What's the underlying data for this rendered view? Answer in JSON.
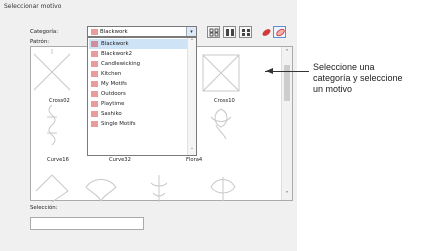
{
  "dialog": {
    "title": "Seleccionar motivo",
    "category_label": "Categoría:",
    "pattern_label": "Patrón:",
    "selection_label": "Selección:",
    "selected_category": "Blackwork"
  },
  "dropdown_items": [
    {
      "label": "Blackwork"
    },
    {
      "label": "Blackwork2"
    },
    {
      "label": "Candlewicking"
    },
    {
      "label": "Kitchen"
    },
    {
      "label": "My Motifs"
    },
    {
      "label": "Outdoors"
    },
    {
      "label": "Playtime"
    },
    {
      "label": "Sashiko"
    },
    {
      "label": "Single Motifs"
    }
  ],
  "motifs": [
    {
      "label": "Cross02"
    },
    {
      "label": "Cross10"
    },
    {
      "label": "Curve16"
    },
    {
      "label": "Curve32"
    },
    {
      "label": "Flora4"
    }
  ],
  "callout": {
    "line1": "Seleccione una",
    "line2": "categoría y seleccione",
    "line3": "un motivo"
  },
  "colors": {
    "accent_red": "#d23a3a",
    "highlight": "#cfe3f7"
  }
}
